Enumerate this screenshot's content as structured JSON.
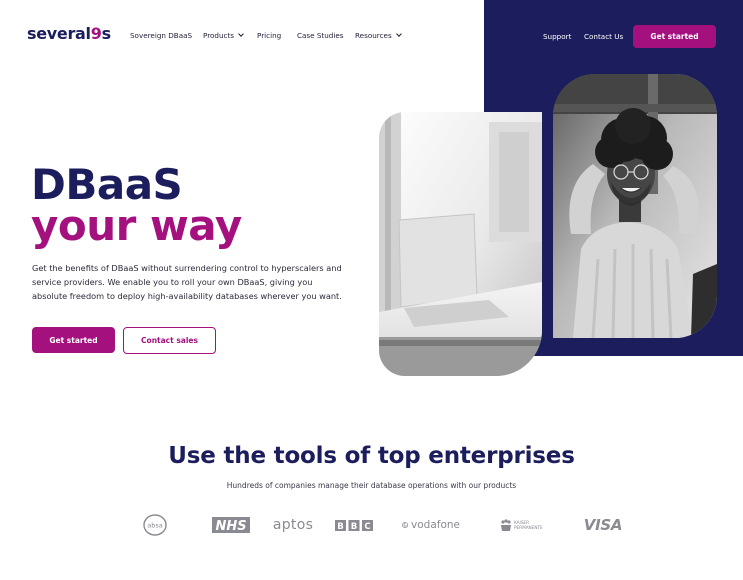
{
  "header": {
    "logo": {
      "text_main": "several",
      "text_nine": "9",
      "text_tail": "s"
    },
    "nav": [
      {
        "label": "Sovereign DBaaS",
        "dropdown": false
      },
      {
        "label": "Products",
        "dropdown": true
      },
      {
        "label": "Pricing",
        "dropdown": false
      },
      {
        "label": "Case Studies",
        "dropdown": false
      },
      {
        "label": "Resources",
        "dropdown": true
      }
    ],
    "support_label": "Support",
    "contact_label": "Contact Us",
    "cta_label": "Get started"
  },
  "hero": {
    "title_line1": "DBaaS",
    "title_line2": "your way",
    "description": "Get the benefits of DBaaS without surrendering control to hyperscalers and service providers. We enable you to roll your own DBaaS, giving you absolute freedom to deploy high-availability databases wherever you want.",
    "primary_button": "Get started",
    "secondary_button": "Contact sales"
  },
  "tools": {
    "title": "Use the tools of top enterprises",
    "subtitle": "Hundreds of companies manage their database operations with our products",
    "brands": [
      {
        "name": "absa",
        "icon": "absa-logo"
      },
      {
        "name": "NHS",
        "icon": "nhs-logo"
      },
      {
        "name": "aptos",
        "icon": "aptos-logo"
      },
      {
        "name": "BBC",
        "icon": "bbc-logo"
      },
      {
        "name": "vodafone",
        "icon": "vodafone-logo"
      },
      {
        "name": "KAISER PERMANENTE",
        "icon": "kaiser-permanente-logo"
      },
      {
        "name": "VISA",
        "icon": "visa-logo"
      }
    ]
  },
  "colors": {
    "brand_magenta": "#a4117e",
    "brand_navy": "#1b1d5c",
    "logo_gray": "#8a8a92"
  }
}
